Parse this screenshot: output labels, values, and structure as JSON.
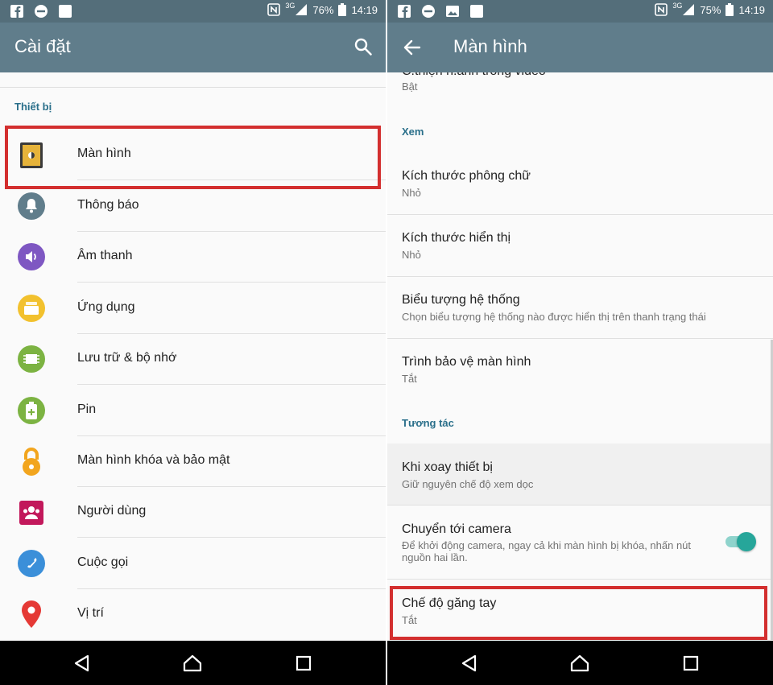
{
  "left": {
    "status": {
      "battery": "76%",
      "time": "14:19",
      "network": "3G"
    },
    "appbar": {
      "title": "Cài đặt",
      "search_icon": "search-icon"
    },
    "section": "Thiết bị",
    "items": [
      {
        "label": "Màn hình",
        "icon": "display-icon",
        "color": "#c8a02a"
      },
      {
        "label": "Thông báo",
        "icon": "bell-icon",
        "color": "#607d8b"
      },
      {
        "label": "Âm thanh",
        "icon": "speaker-icon",
        "color": "#7e57c2"
      },
      {
        "label": "Ứng dụng",
        "icon": "apps-icon",
        "color": "#f2c12e"
      },
      {
        "label": "Lưu trữ & bộ nhớ",
        "icon": "storage-icon",
        "color": "#7cb342"
      },
      {
        "label": "Pin",
        "icon": "battery-icon",
        "color": "#7cb342"
      },
      {
        "label": "Màn hình khóa và bảo mật",
        "icon": "lock-icon",
        "color": "#f2a51e"
      },
      {
        "label": "Người dùng",
        "icon": "users-icon",
        "color": "#c2185b"
      },
      {
        "label": "Cuộc gọi",
        "icon": "phone-icon",
        "color": "#3b8fd9"
      },
      {
        "label": "Vị trí",
        "icon": "location-icon",
        "color": "#e53935"
      }
    ]
  },
  "right": {
    "status": {
      "battery": "75%",
      "time": "14:19",
      "network": "3G"
    },
    "appbar": {
      "title": "Màn hình"
    },
    "partial_item": {
      "title": "C.thiện h.ảnh trong video",
      "sub": "Bật"
    },
    "section_view": "Xem",
    "items_view": [
      {
        "title": "Kích thước phông chữ",
        "sub": "Nhỏ"
      },
      {
        "title": "Kích thước hiển thị",
        "sub": "Nhỏ"
      },
      {
        "title": "Biểu tượng hệ thống",
        "sub": "Chọn biểu tượng hệ thống nào được hiển thị trên thanh trạng thái"
      },
      {
        "title": "Trình bảo vệ màn hình",
        "sub": "Tắt"
      }
    ],
    "section_interact": "Tương tác",
    "items_interact": [
      {
        "title": "Khi xoay thiết bị",
        "sub": "Giữ nguyên chế độ xem dọc"
      },
      {
        "title": "Chuyển tới camera",
        "sub1": "Để khởi động camera, ngay cả khi màn hình bị khóa, nhấn nút",
        "sub2": "nguồn hai lần.",
        "toggle_on": true
      },
      {
        "title": "Chế độ găng tay",
        "sub": "Tắt"
      }
    ]
  },
  "colors": {
    "statusbar": "#546e7a",
    "appbar": "#607d8b",
    "accent": "#26a69a",
    "highlight": "#d32f2f",
    "section": "#2a6f8a"
  }
}
